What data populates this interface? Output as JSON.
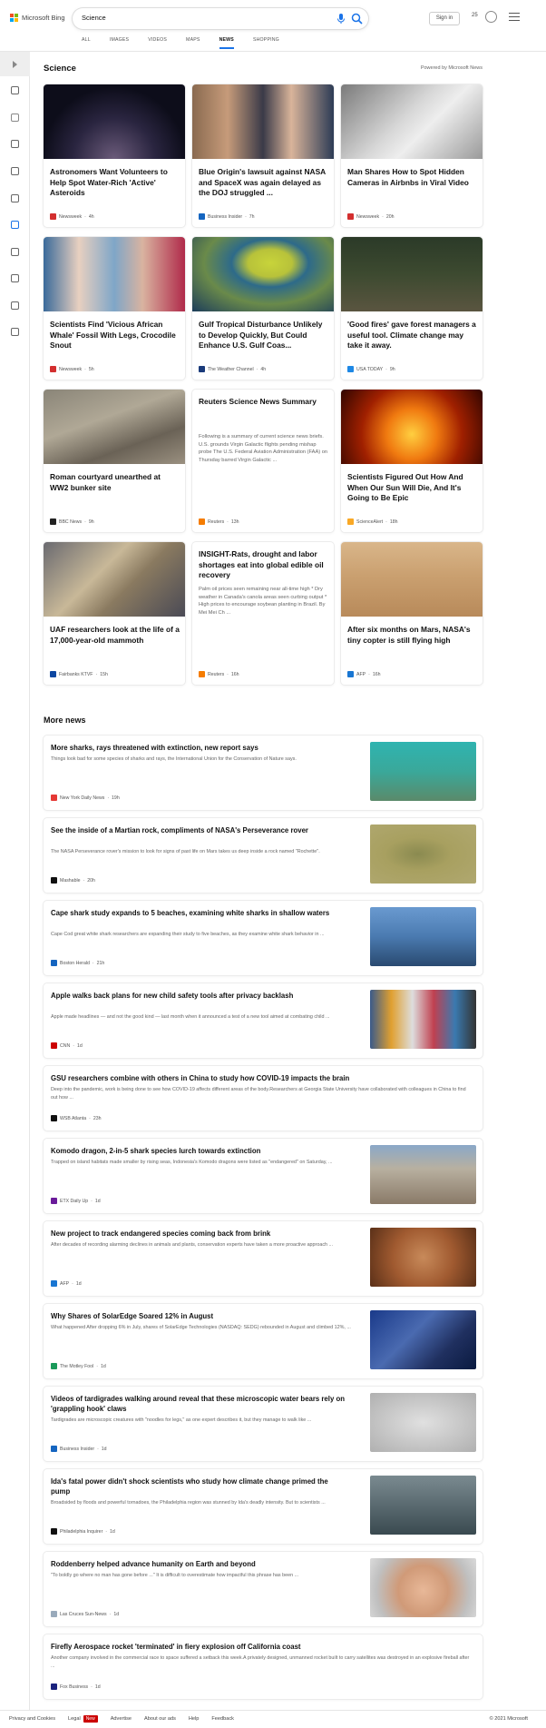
{
  "header": {
    "logo_text": "Microsoft Bing",
    "query": "Science",
    "signin": "Sign in",
    "rewards": "25",
    "tabs": [
      "ALL",
      "IMAGES",
      "VIDEOS",
      "MAPS",
      "NEWS",
      "SHOPPING"
    ],
    "active_tab": "NEWS"
  },
  "section": {
    "title": "Science",
    "powered": "Powered by Microsoft News"
  },
  "cards": [
    {
      "title": "Astronomers Want Volunteers to Help Spot Water-Rich 'Active' Asteroids",
      "source": "Newsweek",
      "time": "4h",
      "fav": "#d32f2f",
      "img": "radial-gradient(circle at 50% 100%,#6b5b7a 0%,#2a2540 40%,#0d0d1a 70%)"
    },
    {
      "title": "Blue Origin's lawsuit against NASA and SpaceX was again delayed as the DOJ struggled ...",
      "source": "Business Insider",
      "time": "7h",
      "fav": "#1565c0",
      "img": "linear-gradient(90deg,#8a6a50 0%,#c69b7a 25%,#3a3a48 50%,#d9b49a 70%,#2c3b55 100%)"
    },
    {
      "title": "Man Shares How to Spot Hidden Cameras in Airbnbs in Viral Video",
      "source": "Newsweek",
      "time": "20h",
      "fav": "#d32f2f",
      "img": "linear-gradient(135deg,#7a7a7a 0%,#d7d7d7 45%,#eeeeee 60%,#9a9a9a 100%)"
    },
    {
      "title": "Scientists Find 'Vicious African Whale' Fossil With Legs, Crocodile Snout",
      "source": "Newsweek",
      "time": "5h",
      "fav": "#d32f2f",
      "img": "linear-gradient(90deg,#3a6a9a 0%,#e8d0c0 25%,#7fa6c8 50%,#d9b3a0 70%,#b02a4a 100%)"
    },
    {
      "title": "Gulf Tropical Disturbance Unlikely to Develop Quickly, But Could Enhance U.S. Gulf Coas...",
      "source": "The Weather Channel",
      "time": "4h",
      "fav": "#1a3a7a",
      "img": "radial-gradient(ellipse at 55% 35%,#c8d43a 0%,#b8c23a 20%,#2d6a8a 35%,#6a8a4a 60%,#1c3d5a 100%)"
    },
    {
      "title": "'Good fires' gave forest managers a useful tool. Climate change may take it away.",
      "source": "USA TODAY",
      "time": "9h",
      "fav": "#1e88e5",
      "img": "linear-gradient(180deg,#2b3a28 0%,#3d4a30 50%,#5a5540 100%)"
    },
    {
      "title": "Roman courtyard unearthed at WW2 bunker site",
      "source": "BBC News",
      "time": "9h",
      "fav": "#222",
      "img": "linear-gradient(160deg,#8a8578 0%,#b0a896 40%,#6a6256 70%,#9a9080 100%)"
    },
    {
      "title": "Reuters Science News Summary",
      "snippet": "Following is a summary of current science news briefs. U.S. grounds Virgin Galactic flights pending mishap probe The U.S. Federal Aviation Administration (FAA) on Thursday barred Virgin Galactic ...",
      "source": "Reuters",
      "time": "13h",
      "fav": "#f57c00",
      "text_only": true
    },
    {
      "title": "Scientists Figured Out How And When Our Sun Will Die, And It's Going to Be Epic",
      "source": "ScienceAlert",
      "time": "18h",
      "fav": "#f9a825",
      "img": "radial-gradient(circle at 50% 60%,#ffcf40 0%,#f07a10 30%,#a02000 60%,#300500 100%)"
    },
    {
      "title": "UAF researchers look at the life of a 17,000-year-old mammoth",
      "source": "Fairbanks KTVF",
      "time": "15h",
      "fav": "#0d47a1",
      "img": "linear-gradient(135deg,#6a6a70 0%,#c8b898 40%,#8a7a60 60%,#4a4a55 100%)"
    },
    {
      "title": "INSIGHT-Rats, drought and labor shortages eat into global edible oil recovery",
      "snippet": "Palm oil prices seen remaining near all-time high * Dry weather in Canada's canola areas seen curbing output * High prices to encourage soybean planting in Brazil. By Mei Mei Ch ...",
      "source": "Reuters",
      "time": "16h",
      "fav": "#f57c00",
      "text_only": true
    },
    {
      "title": "After six months on Mars, NASA's tiny copter is still flying high",
      "source": "AFP",
      "time": "16h",
      "fav": "#1976d2",
      "img": "linear-gradient(180deg,#d9b68a 0%,#caa070 45%,#b88a5a 100%)"
    }
  ],
  "more_news": {
    "title": "More news",
    "items": [
      {
        "title": "More sharks, rays threatened with extinction, new report says",
        "snippet": "Things look bad for some species of sharks and rays, the International Union for the Conservation of Nature says.",
        "source": "New York Daily News",
        "time": "19h",
        "fav": "#e53935",
        "thumb": "linear-gradient(180deg,#2fb4b0 0%,#3aa89a 50%,#5a8a6a 100%)",
        "h": 82
      },
      {
        "title": "See the inside of a Martian rock, compliments of NASA's Perseverance rover",
        "snippet": "The NASA Perseverance rover's mission to look for signs of past life on Mars takes us deep inside a rock named \"Rochette\".",
        "source": "Mashable",
        "time": "20h",
        "fav": "#111",
        "thumb": "radial-gradient(ellipse at 45% 50%,#8a8a50 0%,#a8a060 40%,#b0a870 100%)",
        "h": 82
      },
      {
        "title": "Cape shark study expands to 5 beaches, examining white sharks in shallow waters",
        "snippet": "Cape Cod great white shark researchers are expanding their study to five beaches, as they examine white shark behavior in ...",
        "source": "Boston Herald",
        "time": "21h",
        "fav": "#1565c0",
        "thumb": "linear-gradient(180deg,#6a9ad0 0%,#4a7ab0 50%,#2a4a70 100%)",
        "h": 82
      },
      {
        "title": "Apple walks back plans for new child safety tools after privacy backlash",
        "snippet": "Apple made headlines — and not the good kind — last month when it announced a test of a new tool aimed at combating child ...",
        "source": "CNN",
        "time": "1d",
        "fav": "#cc0000",
        "thumb": "linear-gradient(90deg,#3a5a8a 0%,#e0a030 20%,#ddd 40%,#c04050 60%,#3a7ab0 80%,#333 100%)",
        "h": 82
      },
      {
        "title": "GSU researchers combine with others in China to study how COVID-19 impacts the brain",
        "snippet": "Deep into the pandemic, work is being done to see how COVID-19 affects different areas of the body.Researchers at Georgia State University have collaborated with colleagues in China to find out how ...",
        "source": "WSB Atlanta",
        "time": "23h",
        "fav": "#111",
        "thumb": "",
        "h": 71
      },
      {
        "title": "Komodo dragon, 2-in-5 shark species lurch towards extinction",
        "snippet": "Trapped on island habitats made smaller by rising seas, Indonesia's Komodo dragons were listed as \"endangered\" on Saturday, ...",
        "source": "ETX Daily Up",
        "time": "1d",
        "fav": "#6a1b9a",
        "thumb": "linear-gradient(180deg,#8aa8c8 0%,#b8b0a0 40%,#8a7a68 100%)",
        "h": 82
      },
      {
        "title": "New project to track endangered species coming back from brink",
        "snippet": "After decades of recording alarming declines in animals and plants, conservation experts have taken a more proactive approach ...",
        "source": "AFP",
        "time": "1d",
        "fav": "#1976d2",
        "thumb": "radial-gradient(circle at 50% 50%,#c88a5a 0%,#a05a30 50%,#5a3018 100%)",
        "h": 82
      },
      {
        "title": "Why Shares of SolarEdge Soared 12% in August",
        "snippet": "What happened After dropping 6% in July, shares of SolarEdge Technologies (NASDAQ: SEDG) rebounded in August and climbed 12%, ...",
        "source": "The Motley Fool",
        "time": "1d",
        "fav": "#1a9a5a",
        "thumb": "linear-gradient(135deg,#1a3a8a 0%,#4a6ab0 40%,#203060 70%,#0a1a40 100%)",
        "h": 82
      },
      {
        "title": "Videos of tardigrades walking around reveal that these microscopic water bears rely on 'grappling hook' claws",
        "snippet": "Tardigrades are microscopic creatures with \"noodles for legs,\" as one expert describes it, but they manage to walk like ...",
        "source": "Business Insider",
        "time": "1d",
        "fav": "#1565c0",
        "thumb": "radial-gradient(ellipse at 50% 50%,#e0e0e0 0%,#c8c8c8 50%,#b0b0b0 100%)",
        "h": 82
      },
      {
        "title": "Ida's fatal power didn't shock scientists who study how climate change primed the pump",
        "snippet": "Broadsided by floods and powerful tornadoes, the Philadelphia region was stunned by Ida's deadly intensity. But to scientists ...",
        "source": "Philadelphia Inquirer",
        "time": "1d",
        "fav": "#111",
        "thumb": "linear-gradient(180deg,#7a8a90 0%,#5a6a70 50%,#3a4a50 100%)",
        "h": 82
      },
      {
        "title": "Roddenberry helped advance humanity on Earth and beyond",
        "snippet": "\"To boldly go where no man has gone before ...\" It is difficult to overestimate how impactful this phrase has been ...",
        "source": "Las Cruces Sun-News",
        "time": "1d",
        "fav": "#9ab",
        "thumb": "radial-gradient(circle at 50% 55%,#e8b898 0%,#d09a78 40%,#c0c0c0 75%,#dadada 100%)",
        "h": 82
      },
      {
        "title": "Firefly Aerospace rocket 'terminated' in fiery explosion off California coast",
        "snippet": "Another company involved in the commercial race to space suffered a setback this week.A privately designed, unmanned rocket built to carry satellites was destroyed in an explosive fireball after ...",
        "source": "Fox Business",
        "time": "1d",
        "fav": "#1a237e",
        "thumb": "",
        "h": 71
      }
    ]
  },
  "footer": {
    "links": [
      "Privacy and Cookies",
      "Legal",
      "Advertise",
      "About our ads",
      "Help",
      "Feedback"
    ],
    "new_badge": "New",
    "copyright": "© 2021 Microsoft"
  },
  "colors": {
    "accent": "#1a73e8",
    "brand_red": "#f25022",
    "brand_green": "#7fba00",
    "brand_blue": "#00a4ef",
    "brand_yellow": "#ffb900"
  },
  "rail_icons": [
    "expand-icon",
    "home-icon",
    "tools-icon",
    "flag-icon",
    "location-icon",
    "globe-icon",
    "science-icon",
    "rocket-icon",
    "media-icon",
    "bank-icon",
    "card-icon"
  ]
}
